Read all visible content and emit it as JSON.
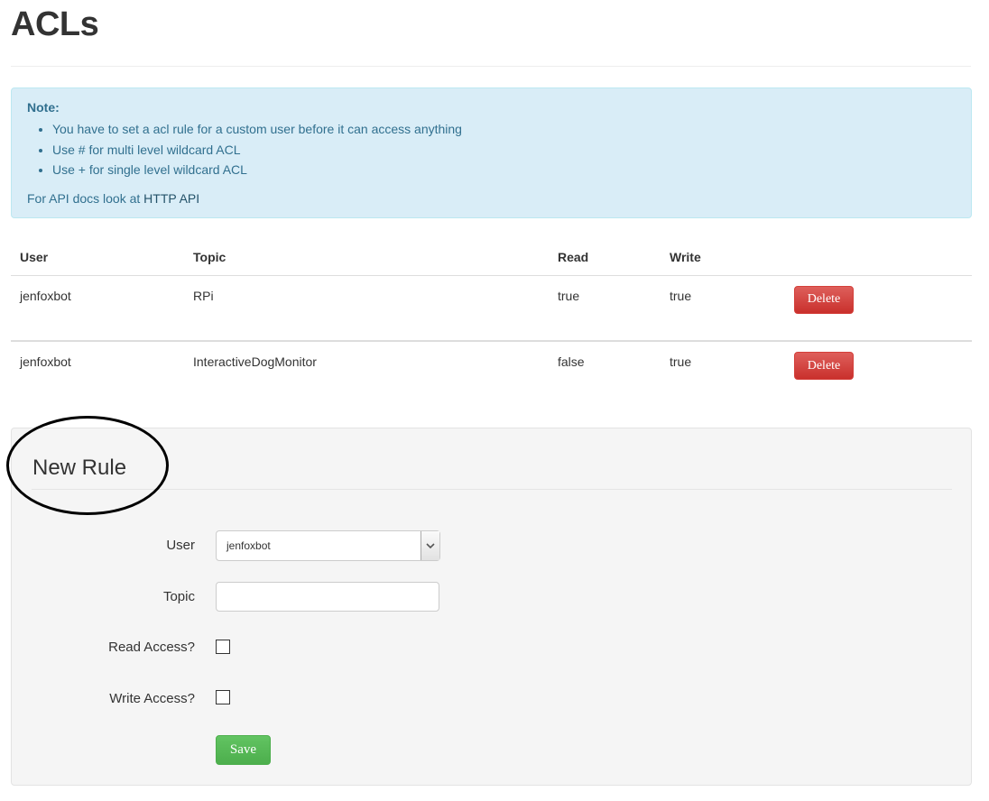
{
  "page": {
    "title": "ACLs"
  },
  "note": {
    "title": "Note:",
    "items": [
      "You have to set a acl rule for a custom user before it can access anything",
      "Use # for multi level wildcard ACL",
      "Use + for single level wildcard ACL"
    ],
    "api_prefix": "For API docs look at ",
    "api_link": "HTTP API"
  },
  "table": {
    "headers": {
      "user": "User",
      "topic": "Topic",
      "read": "Read",
      "write": "Write"
    },
    "rows": [
      {
        "user": "jenfoxbot",
        "topic": "RPi",
        "read": "true",
        "write": "true",
        "action": "Delete"
      },
      {
        "user": "jenfoxbot",
        "topic": "InteractiveDogMonitor",
        "read": "false",
        "write": "true",
        "action": "Delete"
      }
    ]
  },
  "form": {
    "title": "New Rule",
    "user_label": "User",
    "user_value": "jenfoxbot",
    "topic_label": "Topic",
    "topic_value": "",
    "read_label": "Read Access?",
    "write_label": "Write Access?",
    "save_label": "Save"
  },
  "colors": {
    "note_bg": "#d9edf7",
    "note_text": "#31708f",
    "danger": "#d9534f",
    "success": "#5cb85c"
  }
}
